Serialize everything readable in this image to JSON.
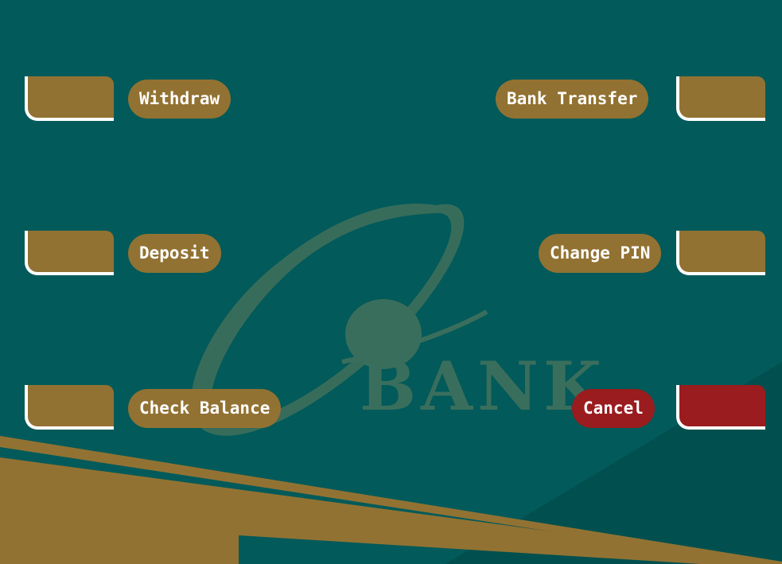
{
  "colors": {
    "background": "#025a5a",
    "gold": "#927232",
    "cancel_red": "#9a1c1e",
    "text": "#ffffff",
    "logo": "#3a6e5c"
  },
  "logo": {
    "text": "BANK"
  },
  "menu": {
    "withdraw": "Withdraw",
    "deposit": "Deposit",
    "check_balance": "Check Balance",
    "bank_transfer": "Bank Transfer",
    "change_pin": "Change PIN",
    "cancel": "Cancel"
  }
}
